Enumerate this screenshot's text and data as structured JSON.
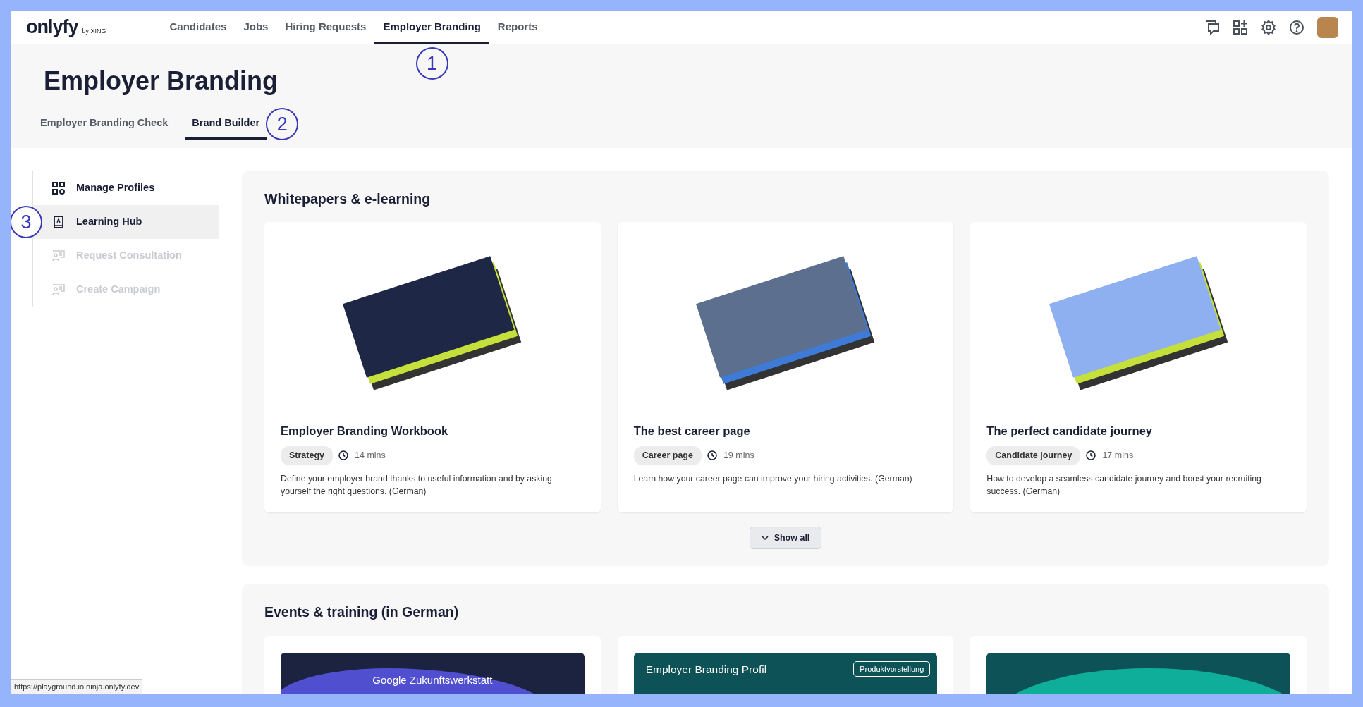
{
  "nav": {
    "logo": "onlyfy",
    "logo_suffix": "by XING",
    "items": [
      {
        "label": "Candidates",
        "selected": false
      },
      {
        "label": "Jobs",
        "selected": false
      },
      {
        "label": "Hiring Requests",
        "selected": false
      },
      {
        "label": "Employer Branding",
        "selected": true,
        "annotation": "1"
      },
      {
        "label": "Reports",
        "selected": false
      }
    ]
  },
  "page_title": "Employer Branding",
  "subtabs": [
    {
      "label": "Employer Branding Check",
      "selected": false
    },
    {
      "label": "Brand Builder",
      "selected": true,
      "annotation": "2"
    }
  ],
  "sidebar": {
    "items": [
      {
        "label": "Manage Profiles",
        "kind": "profiles",
        "selected": false,
        "disabled": false
      },
      {
        "label": "Learning Hub",
        "kind": "book",
        "selected": true,
        "disabled": false,
        "annotation": "3"
      },
      {
        "label": "Request Consultation",
        "kind": "consult",
        "selected": false,
        "disabled": true
      },
      {
        "label": "Create Campaign",
        "kind": "consult",
        "selected": false,
        "disabled": true
      }
    ]
  },
  "whitepapers": {
    "title": "Whitepapers & e-learning",
    "cards": [
      {
        "title": "Employer Branding Workbook",
        "tag": "Strategy",
        "duration": "14 mins",
        "description": "Define your employer brand thanks to useful information and by asking yourself the right questions. (German)"
      },
      {
        "title": "The best career page",
        "tag": "Career page",
        "duration": "19 mins",
        "description": "Learn how your career page can improve your hiring activities. (German)"
      },
      {
        "title": "The perfect candidate journey",
        "tag": "Candidate journey",
        "duration": "17 mins",
        "description": "How to develop a seamless candidate journey and boost your recruiting success. (German)"
      }
    ],
    "show_all": "Show all"
  },
  "events": {
    "title": "Events & training (in German)",
    "cards": [
      {
        "kind": "google",
        "banner_text": "Google Zukunftswerkstatt"
      },
      {
        "kind": "product",
        "banner_text": "Employer Branding Profil",
        "badge": "Produktvorstellung"
      },
      {
        "kind": "wave"
      }
    ]
  },
  "status_url": "https://playground.io.ninja.onlyfy.dev"
}
